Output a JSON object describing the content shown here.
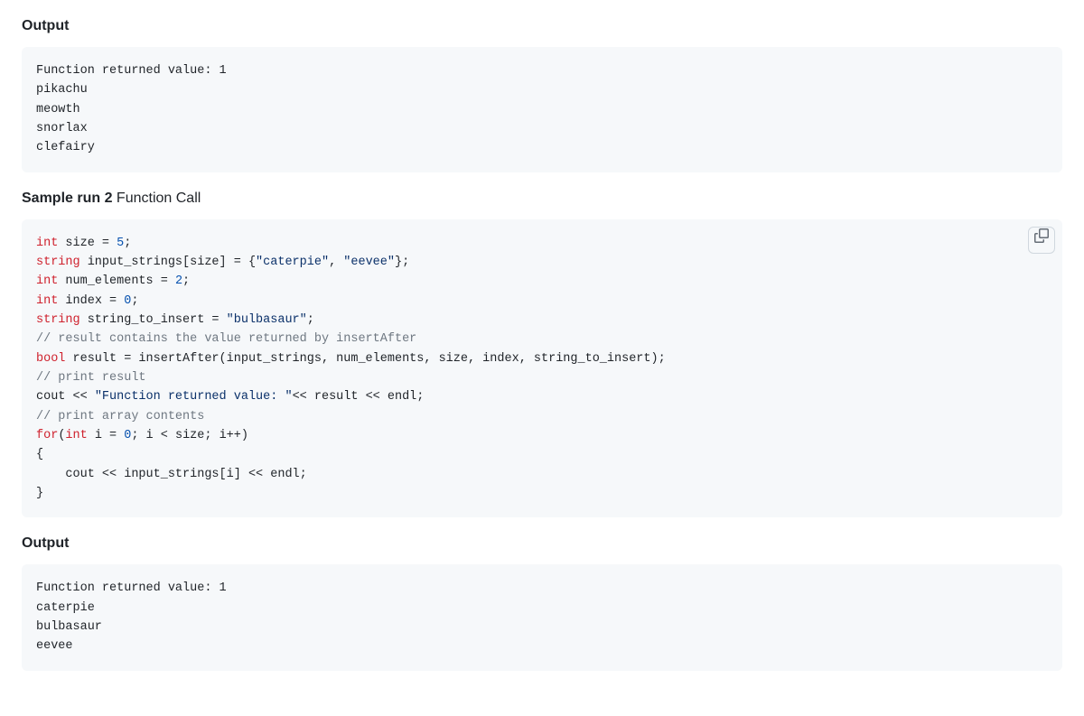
{
  "sections": {
    "output1": {
      "heading": "Output",
      "content": "Function returned value: 1\npikachu\nmeowth\nsnorlax\nclefairy"
    },
    "sample2": {
      "heading_bold": "Sample run 2 ",
      "heading_regular": "Function Call",
      "code": {
        "l1_t": "int",
        "l1_r": " size = ",
        "l1_n": "5",
        "l1_e": ";",
        "l2_t": "string",
        "l2_r": " input_strings[size] = {",
        "l2_s1": "\"caterpie\"",
        "l2_c": ", ",
        "l2_s2": "\"eevee\"",
        "l2_e": "};",
        "l3_t": "int",
        "l3_r": " num_elements = ",
        "l3_n": "2",
        "l3_e": ";",
        "l4_t": "int",
        "l4_r": " index = ",
        "l4_n": "0",
        "l4_e": ";",
        "l5_t": "string",
        "l5_r": " string_to_insert = ",
        "l5_s": "\"bulbasaur\"",
        "l5_e": ";",
        "l6_c": "// result contains the value returned by insertAfter",
        "l7_t": "bool",
        "l7_r": " result = insertAfter(input_strings, num_elements, size, index, string_to_insert);",
        "l8_c": "// print result",
        "l9_a": "cout << ",
        "l9_s": "\"Function returned value: \"",
        "l9_b": "<< result << endl;",
        "l10_c": "// print array contents",
        "l11_k": "for",
        "l11_a": "(",
        "l11_t": "int",
        "l11_b": " i = ",
        "l11_n": "0",
        "l11_c2": "; i < size; i++)",
        "l12": "{",
        "l13": "    cout << input_strings[i] << endl;",
        "l14": "}"
      }
    },
    "output2": {
      "heading": "Output",
      "content": "Function returned value: 1\ncaterpie\nbulbasaur\neevee"
    }
  }
}
